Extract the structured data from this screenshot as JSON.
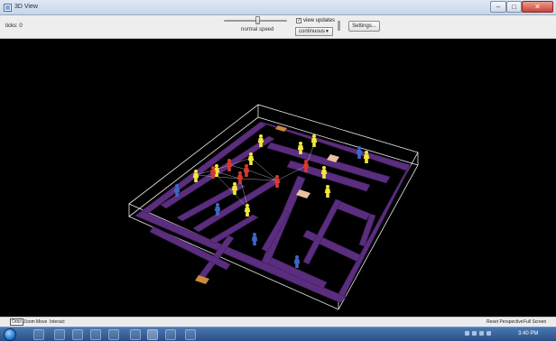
{
  "window": {
    "title": "3D View",
    "minimize_label": "–",
    "maximize_label": "□",
    "close_label": "✕"
  },
  "toolbar": {
    "ticks": "ticks: 0",
    "speed_label": "normal speed",
    "speed_level": 0.5,
    "view_updates_checked": true,
    "view_updates_label": "view updates",
    "update_mode": "continuous",
    "settings_label": "Settings..."
  },
  "bottom": {
    "orbit": "Orbit",
    "zoom": "Zoom",
    "move": "Move",
    "interact": "Interact",
    "reset_perspective": "Reset Perspective",
    "full_screen": "Full Screen"
  },
  "taskbar": {
    "clock": "3:40 PM",
    "apps": [
      "ie-icon",
      "media-icon",
      "explorer-icon",
      "skype-icon",
      "word-icon",
      "chrome-icon",
      "netlogo-icon",
      "paint-icon",
      "network-icon"
    ]
  },
  "colors": {
    "wall": "#5b2d7e",
    "wall_dark": "#3f1f5a",
    "floor": "#000000",
    "patch_light": "#e8c2a0",
    "patch_orange": "#c98a3d",
    "agent_yellow": "#f2e83a",
    "agent_red": "#d63a2f",
    "agent_blue": "#3e67c6"
  }
}
